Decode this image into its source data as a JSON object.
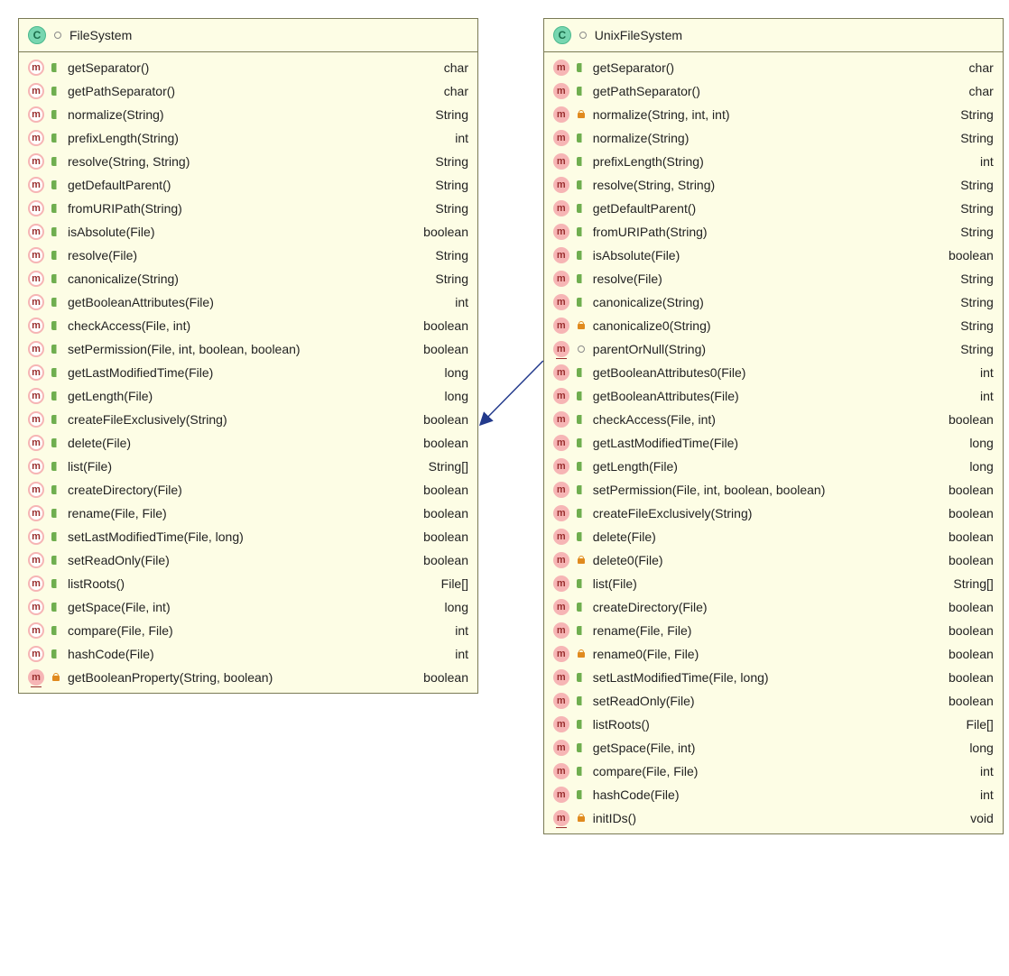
{
  "classes": [
    {
      "id": "FileSystem",
      "title": "FileSystem",
      "members": [
        {
          "sig": "getSeparator()",
          "ret": "char",
          "mk": "abs",
          "vis": "open"
        },
        {
          "sig": "getPathSeparator()",
          "ret": "char",
          "mk": "abs",
          "vis": "open"
        },
        {
          "sig": "normalize(String)",
          "ret": "String",
          "mk": "abs",
          "vis": "open"
        },
        {
          "sig": "prefixLength(String)",
          "ret": "int",
          "mk": "abs",
          "vis": "open"
        },
        {
          "sig": "resolve(String, String)",
          "ret": "String",
          "mk": "abs",
          "vis": "open"
        },
        {
          "sig": "getDefaultParent()",
          "ret": "String",
          "mk": "abs",
          "vis": "open"
        },
        {
          "sig": "fromURIPath(String)",
          "ret": "String",
          "mk": "abs",
          "vis": "open"
        },
        {
          "sig": "isAbsolute(File)",
          "ret": "boolean",
          "mk": "abs",
          "vis": "open"
        },
        {
          "sig": "resolve(File)",
          "ret": "String",
          "mk": "abs",
          "vis": "open"
        },
        {
          "sig": "canonicalize(String)",
          "ret": "String",
          "mk": "abs",
          "vis": "open"
        },
        {
          "sig": "getBooleanAttributes(File)",
          "ret": "int",
          "mk": "abs",
          "vis": "open"
        },
        {
          "sig": "checkAccess(File, int)",
          "ret": "boolean",
          "mk": "abs",
          "vis": "open"
        },
        {
          "sig": "setPermission(File, int, boolean, boolean)",
          "ret": "boolean",
          "mk": "abs",
          "vis": "open"
        },
        {
          "sig": "getLastModifiedTime(File)",
          "ret": "long",
          "mk": "abs",
          "vis": "open"
        },
        {
          "sig": "getLength(File)",
          "ret": "long",
          "mk": "abs",
          "vis": "open"
        },
        {
          "sig": "createFileExclusively(String)",
          "ret": "boolean",
          "mk": "abs",
          "vis": "open"
        },
        {
          "sig": "delete(File)",
          "ret": "boolean",
          "mk": "abs",
          "vis": "open"
        },
        {
          "sig": "list(File)",
          "ret": "String[]",
          "mk": "abs",
          "vis": "open"
        },
        {
          "sig": "createDirectory(File)",
          "ret": "boolean",
          "mk": "abs",
          "vis": "open"
        },
        {
          "sig": "rename(File, File)",
          "ret": "boolean",
          "mk": "abs",
          "vis": "open"
        },
        {
          "sig": "setLastModifiedTime(File, long)",
          "ret": "boolean",
          "mk": "abs",
          "vis": "open"
        },
        {
          "sig": "setReadOnly(File)",
          "ret": "boolean",
          "mk": "abs",
          "vis": "open"
        },
        {
          "sig": "listRoots()",
          "ret": "File[]",
          "mk": "abs",
          "vis": "open"
        },
        {
          "sig": "getSpace(File, int)",
          "ret": "long",
          "mk": "abs",
          "vis": "open"
        },
        {
          "sig": "compare(File, File)",
          "ret": "int",
          "mk": "abs",
          "vis": "open"
        },
        {
          "sig": "hashCode(File)",
          "ret": "int",
          "mk": "abs",
          "vis": "open"
        },
        {
          "sig": "getBooleanProperty(String, boolean)",
          "ret": "boolean",
          "mk": "static",
          "vis": "lock"
        }
      ]
    },
    {
      "id": "UnixFileSystem",
      "title": "UnixFileSystem",
      "members": [
        {
          "sig": "getSeparator()",
          "ret": "char",
          "mk": "",
          "vis": "open"
        },
        {
          "sig": "getPathSeparator()",
          "ret": "char",
          "mk": "",
          "vis": "open"
        },
        {
          "sig": "normalize(String, int, int)",
          "ret": "String",
          "mk": "",
          "vis": "lock"
        },
        {
          "sig": "normalize(String)",
          "ret": "String",
          "mk": "",
          "vis": "open"
        },
        {
          "sig": "prefixLength(String)",
          "ret": "int",
          "mk": "",
          "vis": "open"
        },
        {
          "sig": "resolve(String, String)",
          "ret": "String",
          "mk": "",
          "vis": "open"
        },
        {
          "sig": "getDefaultParent()",
          "ret": "String",
          "mk": "",
          "vis": "open"
        },
        {
          "sig": "fromURIPath(String)",
          "ret": "String",
          "mk": "",
          "vis": "open"
        },
        {
          "sig": "isAbsolute(File)",
          "ret": "boolean",
          "mk": "",
          "vis": "open"
        },
        {
          "sig": "resolve(File)",
          "ret": "String",
          "mk": "",
          "vis": "open"
        },
        {
          "sig": "canonicalize(String)",
          "ret": "String",
          "mk": "",
          "vis": "open"
        },
        {
          "sig": "canonicalize0(String)",
          "ret": "String",
          "mk": "",
          "vis": "lock"
        },
        {
          "sig": "parentOrNull(String)",
          "ret": "String",
          "mk": "static",
          "vis": "pkg"
        },
        {
          "sig": "getBooleanAttributes0(File)",
          "ret": "int",
          "mk": "",
          "vis": "open"
        },
        {
          "sig": "getBooleanAttributes(File)",
          "ret": "int",
          "mk": "",
          "vis": "open"
        },
        {
          "sig": "checkAccess(File, int)",
          "ret": "boolean",
          "mk": "",
          "vis": "open"
        },
        {
          "sig": "getLastModifiedTime(File)",
          "ret": "long",
          "mk": "",
          "vis": "open"
        },
        {
          "sig": "getLength(File)",
          "ret": "long",
          "mk": "",
          "vis": "open"
        },
        {
          "sig": "setPermission(File, int, boolean, boolean)",
          "ret": "boolean",
          "mk": "",
          "vis": "open"
        },
        {
          "sig": "createFileExclusively(String)",
          "ret": "boolean",
          "mk": "",
          "vis": "open"
        },
        {
          "sig": "delete(File)",
          "ret": "boolean",
          "mk": "",
          "vis": "open"
        },
        {
          "sig": "delete0(File)",
          "ret": "boolean",
          "mk": "",
          "vis": "lock"
        },
        {
          "sig": "list(File)",
          "ret": "String[]",
          "mk": "",
          "vis": "open"
        },
        {
          "sig": "createDirectory(File)",
          "ret": "boolean",
          "mk": "",
          "vis": "open"
        },
        {
          "sig": "rename(File, File)",
          "ret": "boolean",
          "mk": "",
          "vis": "open"
        },
        {
          "sig": "rename0(File, File)",
          "ret": "boolean",
          "mk": "",
          "vis": "lock"
        },
        {
          "sig": "setLastModifiedTime(File, long)",
          "ret": "boolean",
          "mk": "",
          "vis": "open"
        },
        {
          "sig": "setReadOnly(File)",
          "ret": "boolean",
          "mk": "",
          "vis": "open"
        },
        {
          "sig": "listRoots()",
          "ret": "File[]",
          "mk": "",
          "vis": "open"
        },
        {
          "sig": "getSpace(File, int)",
          "ret": "long",
          "mk": "",
          "vis": "open"
        },
        {
          "sig": "compare(File, File)",
          "ret": "int",
          "mk": "",
          "vis": "open"
        },
        {
          "sig": "hashCode(File)",
          "ret": "int",
          "mk": "",
          "vis": "open"
        },
        {
          "sig": "initIDs()",
          "ret": "void",
          "mk": "static",
          "vis": "lock"
        }
      ]
    }
  ]
}
